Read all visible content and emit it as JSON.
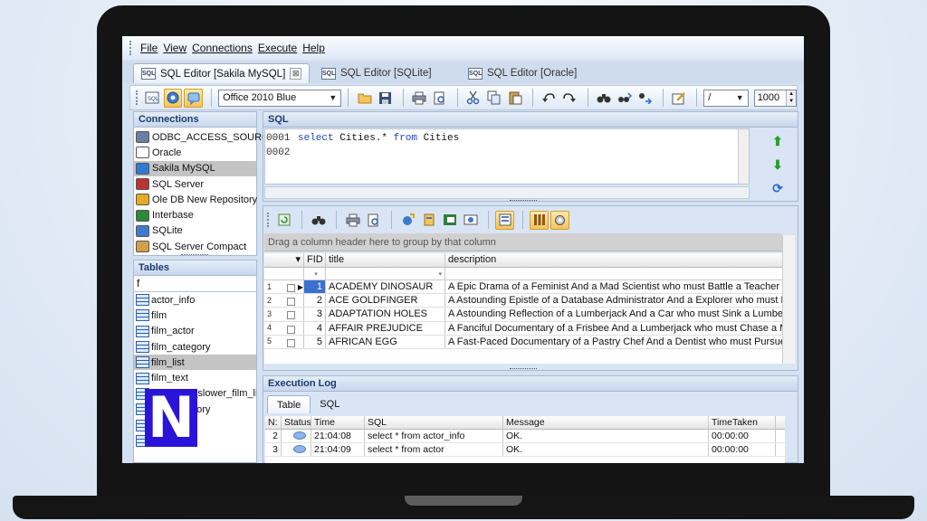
{
  "menu": [
    "File",
    "View",
    "Connections",
    "Execute",
    "Help"
  ],
  "tabs": [
    {
      "label": "SQL Editor [Sakila MySQL]",
      "active": true
    },
    {
      "label": "SQL Editor [SQLite]",
      "active": false
    },
    {
      "label": "SQL Editor [Oracle]",
      "active": false
    }
  ],
  "toolbar": {
    "theme": "Office 2010 Blue",
    "delimiter": "/",
    "limit": "1000"
  },
  "connections": {
    "title": "Connections",
    "items": [
      {
        "label": "ODBC_ACCESS_SOURCE",
        "icon": "odbc-icon"
      },
      {
        "label": "Oracle",
        "icon": "oracle-icon"
      },
      {
        "label": "Sakila MySQL",
        "icon": "mysql-icon",
        "selected": true
      },
      {
        "label": "SQL Server",
        "icon": "sqlserver-icon"
      },
      {
        "label": "Ole DB New Repository",
        "icon": "oledb-icon"
      },
      {
        "label": "Interbase",
        "icon": "interbase-icon"
      },
      {
        "label": "SQLite",
        "icon": "sqlite-icon"
      },
      {
        "label": "SQL Server Compact",
        "icon": "sqlcompact-icon"
      }
    ]
  },
  "tables": {
    "title": "Tables",
    "filter": "f",
    "items": [
      {
        "label": "actor_info"
      },
      {
        "label": "film"
      },
      {
        "label": "film_actor"
      },
      {
        "label": "film_category"
      },
      {
        "label": "film_list",
        "selected": true
      },
      {
        "label": "film_text"
      },
      {
        "label": "nicer_but_slower_film_list"
      },
      {
        "label": "film_category"
      },
      {
        "label": ""
      },
      {
        "label": ""
      }
    ]
  },
  "sql": {
    "title": "SQL",
    "line_numbers": [
      "0001",
      "0002"
    ],
    "kw1": "select",
    "ident1": " Cities.* ",
    "kw2": "from",
    "ident2": " Cities"
  },
  "results": {
    "group_hint": "Drag a column header here to group by that column",
    "columns": [
      "FID",
      "title",
      "description"
    ],
    "rows": [
      {
        "n": "1",
        "fid": "1",
        "title": "ACADEMY DINOSAUR",
        "desc": "A Epic Drama of a Feminist And a Mad Scientist who must Battle a Teacher in Th"
      },
      {
        "n": "2",
        "fid": "2",
        "title": "ACE GOLDFINGER",
        "desc": "A Astounding Epistle of a Database Administrator And a Explorer who must Find"
      },
      {
        "n": "3",
        "fid": "3",
        "title": "ADAPTATION HOLES",
        "desc": "A Astounding Reflection of a Lumberjack And a Car who must Sink a Lumberjacl"
      },
      {
        "n": "4",
        "fid": "4",
        "title": "AFFAIR PREJUDICE",
        "desc": "A Fanciful Documentary of a Frisbee And a Lumberjack who must Chase a Monk"
      },
      {
        "n": "5",
        "fid": "5",
        "title": "AFRICAN EGG",
        "desc": "A Fast-Paced Documentary of a Pastry Chef And a Dentist who must Pursue a"
      }
    ]
  },
  "log": {
    "title": "Execution Log",
    "tabs": [
      "Table",
      "SQL"
    ],
    "columns": [
      "N:",
      "Status",
      "Time",
      "SQL",
      "Message",
      "TimeTaken"
    ],
    "rows": [
      {
        "n": "2",
        "time": "21:04:08",
        "sql": "select * from actor_info",
        "msg": "OK.",
        "taken": "00:00:00"
      },
      {
        "n": "3",
        "time": "21:04:09",
        "sql": "select * from actor",
        "msg": "OK.",
        "taken": "00:00:00"
      }
    ]
  },
  "overlay_letter": "N"
}
